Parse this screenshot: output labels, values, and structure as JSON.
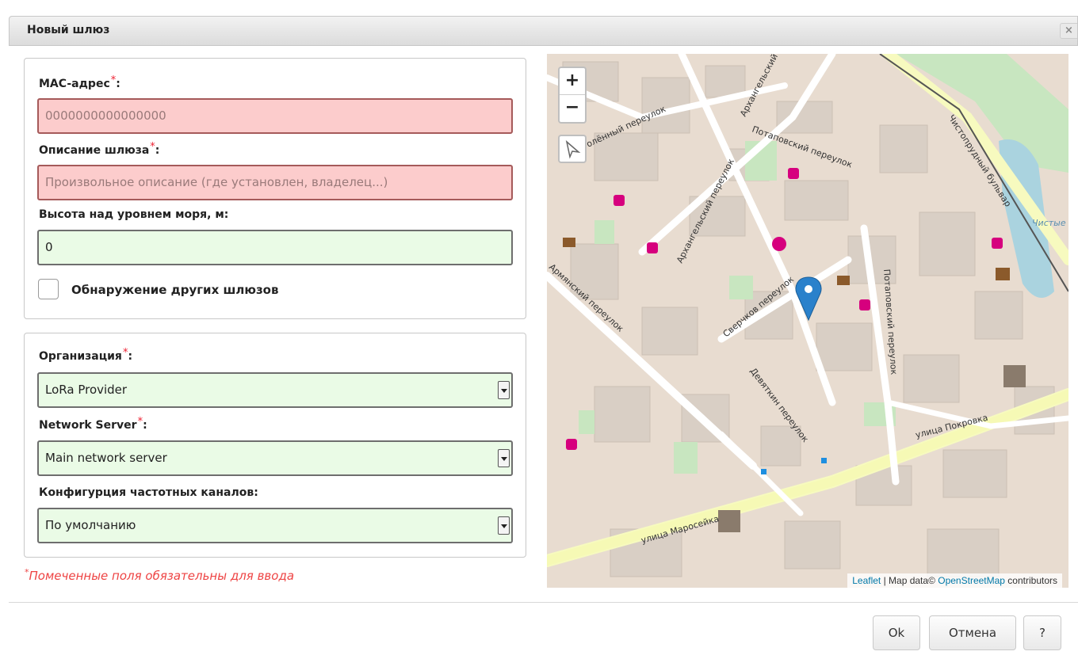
{
  "dialog": {
    "title": "Новый шлюз",
    "close_icon": "×"
  },
  "form": {
    "required_mark": "*",
    "mac": {
      "label": "MAC-адрес",
      "colon": ":",
      "placeholder": "0000000000000000"
    },
    "description": {
      "label": "Описание шлюза",
      "colon": ":",
      "placeholder": "Произвольное описание (где установлен, владелец...)"
    },
    "altitude": {
      "label": "Высота над уровнем моря, м:",
      "value": "0"
    },
    "discovery": {
      "label": "Обнаружение других шлюзов",
      "checked": false
    },
    "organization": {
      "label": "Организация",
      "colon": ":",
      "selected": "LoRa Provider"
    },
    "network_server": {
      "label": "Network Server",
      "colon": ":",
      "selected": "Main network server"
    },
    "channel_config": {
      "label": "Конфигурция частотных каналов:",
      "selected": "По умолчанию"
    },
    "footnote": {
      "star": "*",
      "text": "Помеченные поля обязательны для ввода"
    }
  },
  "map": {
    "zoom_in": "+",
    "zoom_out": "−",
    "streets": {
      "s1": "Потаповский переулок",
      "s2": "Архангельский переулок",
      "s3": "Армянский переулок",
      "s4": "Сверчков переулок",
      "s5": "Девяткин переулок",
      "s6": "улица Покровка",
      "s7": "улица Маросейка",
      "s8": "Чистопрудный бульвар",
      "s9": "Потаповский переулок",
      "s10": "Чистые пруды",
      "s11": "олённый переулок",
      "s12": "Архангельский"
    },
    "attribution": {
      "leaflet": "Leaflet",
      "sep": " | Map data© ",
      "osm": "OpenStreetMap",
      "contributors": " contributors"
    }
  },
  "buttons": {
    "ok": "Ok",
    "cancel": "Отмена",
    "help": "?"
  },
  "colors": {
    "invalid_bg": "#fccccc",
    "valid_bg": "#eafbe6",
    "required": "#e23",
    "marker": "#2a81cb"
  }
}
